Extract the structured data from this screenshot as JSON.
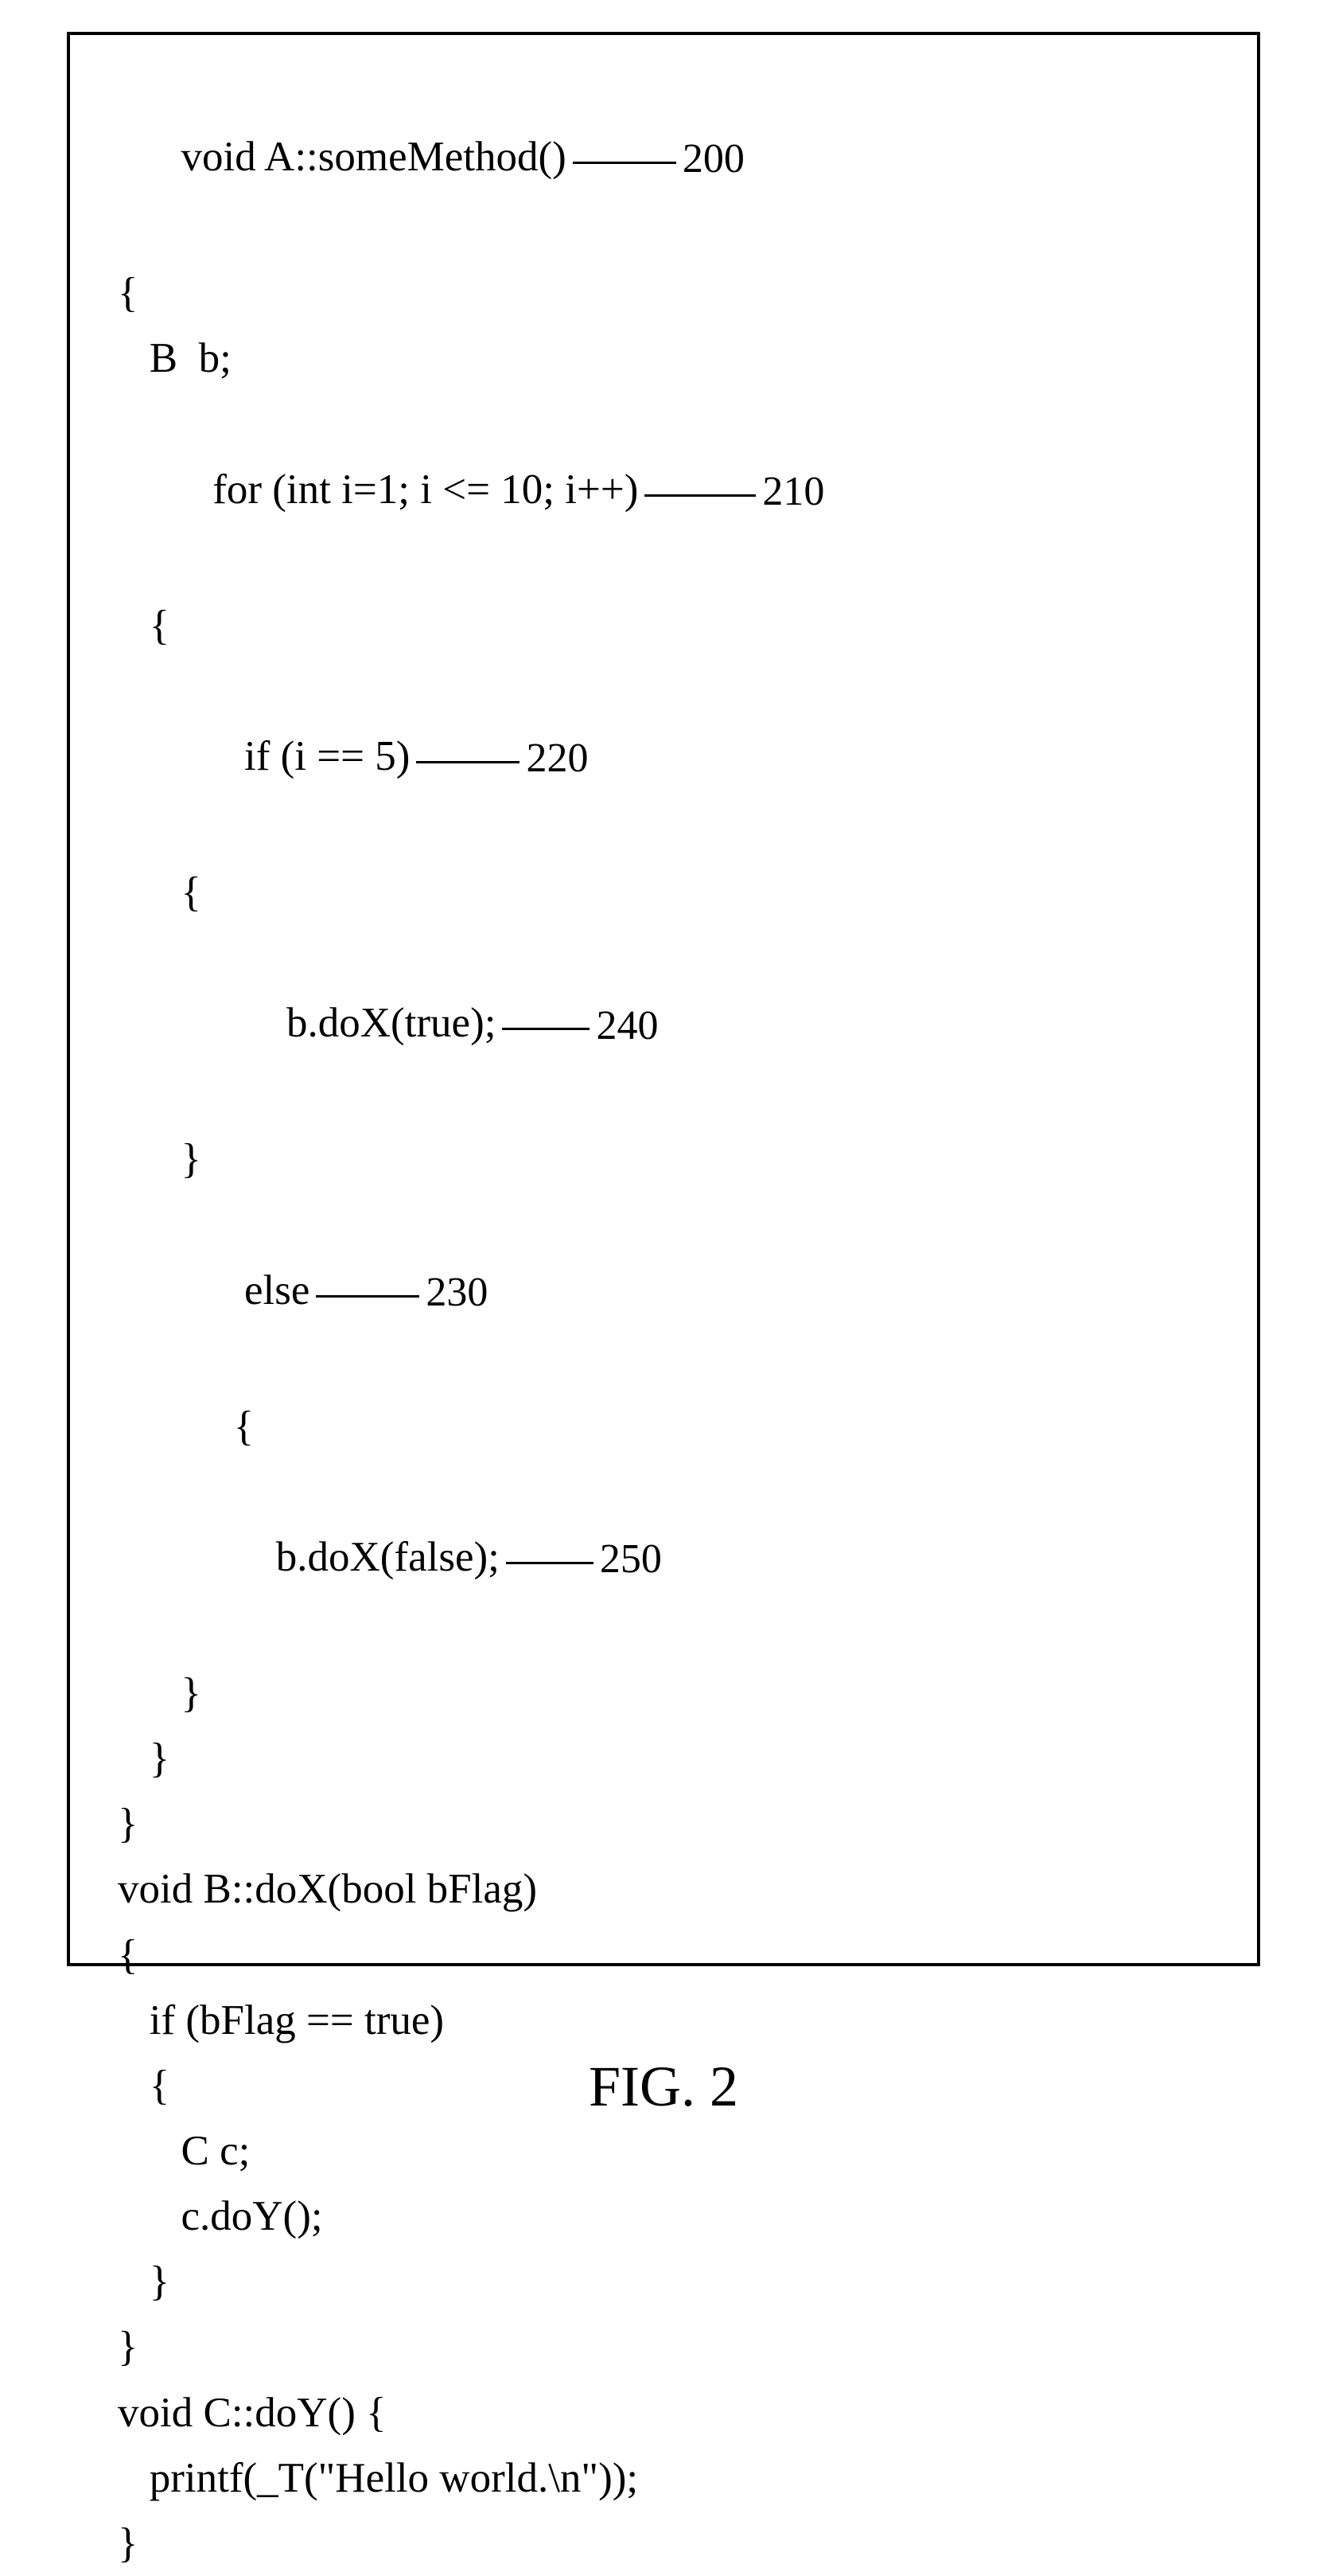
{
  "caption": "FIG. 2",
  "callouts": {
    "c200": "200",
    "c210": "210",
    "c220": "220",
    "c230": "230",
    "c240": "240",
    "c250": "250"
  },
  "code": {
    "l1": "void A::someMethod()",
    "l2": "{",
    "l3": "   B  b;",
    "l4": "",
    "l5": "   for (int i=1; i <= 10; i++)",
    "l6": "   {",
    "l7": "      if (i == 5)",
    "l8": "      {",
    "l9": "          b.doX(true);",
    "l10": "      }",
    "l11": "      else",
    "l12": "           {",
    "l13": "         b.doX(false);",
    "l14": "      }",
    "l15": "   }",
    "l16": "}",
    "l17": "",
    "l18": "void B::doX(bool bFlag)",
    "l19": "{",
    "l20": "",
    "l21": "   if (bFlag == true)",
    "l22": "   {",
    "l23": "      C c;",
    "l24": "      c.doY();",
    "l25": "   }",
    "l26": "}",
    "l27": "",
    "l28": "void C::doY() {",
    "l29": "",
    "l30": "   printf(_T(\"Hello world.\\n\"));",
    "l31": "",
    "l32": "}"
  }
}
